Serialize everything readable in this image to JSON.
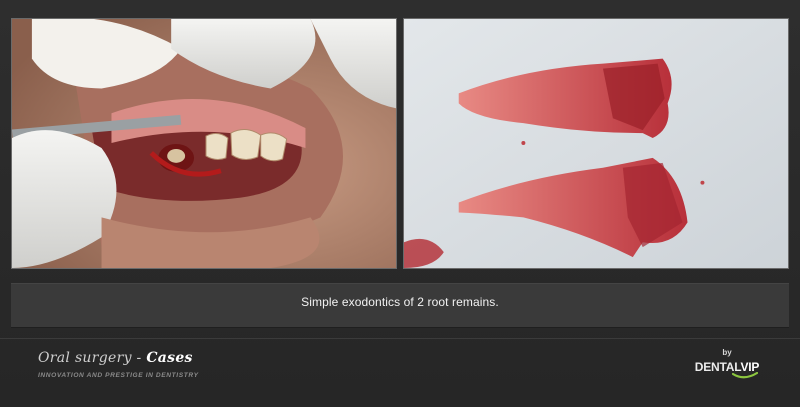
{
  "caption": "Simple exodontics of 2 root remains.",
  "brand": {
    "title_prefix": "Oral surgery - ",
    "title_emphasis": "Cases",
    "tagline": "INNOVATION AND PRESTIGE IN DENTISTRY"
  },
  "logo": {
    "by": "by",
    "dental": "DENTAL",
    "vip": "VIP",
    "swoosh_color": "#8cc63f"
  },
  "photos": {
    "left": "intraoral-extraction-site",
    "right": "extracted-root-remains"
  },
  "colors": {
    "background": "#2b2b2b",
    "caption_bar": "#3a3a3a",
    "caption_text": "#f2f2f2",
    "tagline": "#8a8a8a"
  }
}
